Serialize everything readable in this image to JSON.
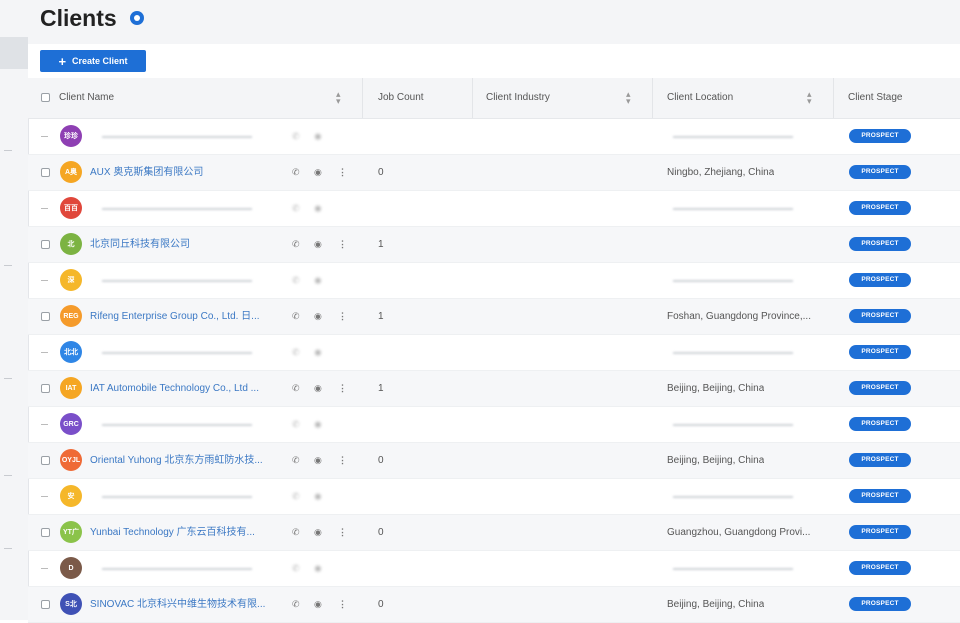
{
  "page": {
    "title": "Clients"
  },
  "toolbar": {
    "create_label": "Create Client"
  },
  "icons": {
    "title": "info-circle-icon",
    "create": "plus-icon",
    "sort": "sort-icon",
    "phone": "phone-icon",
    "view": "eye-icon",
    "more": "more-vertical-icon"
  },
  "colors": {
    "primary": "#1e6fd6",
    "link": "#3b78c4"
  },
  "table": {
    "columns": [
      "Client Name",
      "Job Count",
      "Client Industry",
      "Client Location",
      "Client Stage"
    ],
    "rows": [
      {
        "initials": "珍珍",
        "color": "#8e3fb3",
        "name": "",
        "job": "",
        "location": "",
        "stage": "PROSPECT",
        "blurred": true
      },
      {
        "initials": "A奥",
        "color": "#f5a623",
        "name": "AUX 奥克斯集团有限公司",
        "job": "0",
        "location": "Ningbo, Zhejiang, China",
        "stage": "PROSPECT",
        "blurred": false
      },
      {
        "initials": "百百",
        "color": "#e0473b",
        "name": "",
        "job": "",
        "location": "",
        "stage": "PROSPECT",
        "blurred": true
      },
      {
        "initials": "北",
        "color": "#7cb342",
        "name": "北京同丘科技有限公司",
        "job": "1",
        "location": "",
        "stage": "PROSPECT",
        "blurred": false
      },
      {
        "initials": "深",
        "color": "#f5b72a",
        "name": "",
        "job": "",
        "location": "",
        "stage": "PROSPECT",
        "blurred": true
      },
      {
        "initials": "REG",
        "color": "#f59b2b",
        "name": "Rifeng Enterprise Group Co., Ltd. 日...",
        "job": "1",
        "location": "Foshan, Guangdong Province,...",
        "stage": "PROSPECT",
        "blurred": false
      },
      {
        "initials": "北北",
        "color": "#2f86e6",
        "name": "",
        "job": "",
        "location": "",
        "stage": "PROSPECT",
        "blurred": true
      },
      {
        "initials": "IAT",
        "color": "#f5a623",
        "name": "IAT Automobile Technology Co., Ltd ...",
        "job": "1",
        "location": "Beijing, Beijing, China",
        "stage": "PROSPECT",
        "blurred": false
      },
      {
        "initials": "GRC",
        "color": "#7a4fc9",
        "name": "",
        "job": "",
        "location": "",
        "stage": "PROSPECT",
        "blurred": true
      },
      {
        "initials": "OYJL",
        "color": "#ef6a36",
        "name": "Oriental Yuhong 北京东方雨虹防水技...",
        "job": "0",
        "location": "Beijing, Beijing, China",
        "stage": "PROSPECT",
        "blurred": false
      },
      {
        "initials": "安",
        "color": "#f5b72a",
        "name": "",
        "job": "",
        "location": "",
        "stage": "PROSPECT",
        "blurred": true
      },
      {
        "initials": "YT广",
        "color": "#8bc34a",
        "name": "Yunbai Technology 广东云百科技有...",
        "job": "0",
        "location": "Guangzhou, Guangdong Provi...",
        "stage": "PROSPECT",
        "blurred": false
      },
      {
        "initials": "D",
        "color": "#7b5a49",
        "name": "",
        "job": "",
        "location": "",
        "stage": "PROSPECT",
        "blurred": true
      },
      {
        "initials": "S北",
        "color": "#3f51b5",
        "name": "SINOVAC 北京科兴中维生物技术有限...",
        "job": "0",
        "location": "Beijing, Beijing, China",
        "stage": "PROSPECT",
        "blurred": false
      }
    ]
  }
}
